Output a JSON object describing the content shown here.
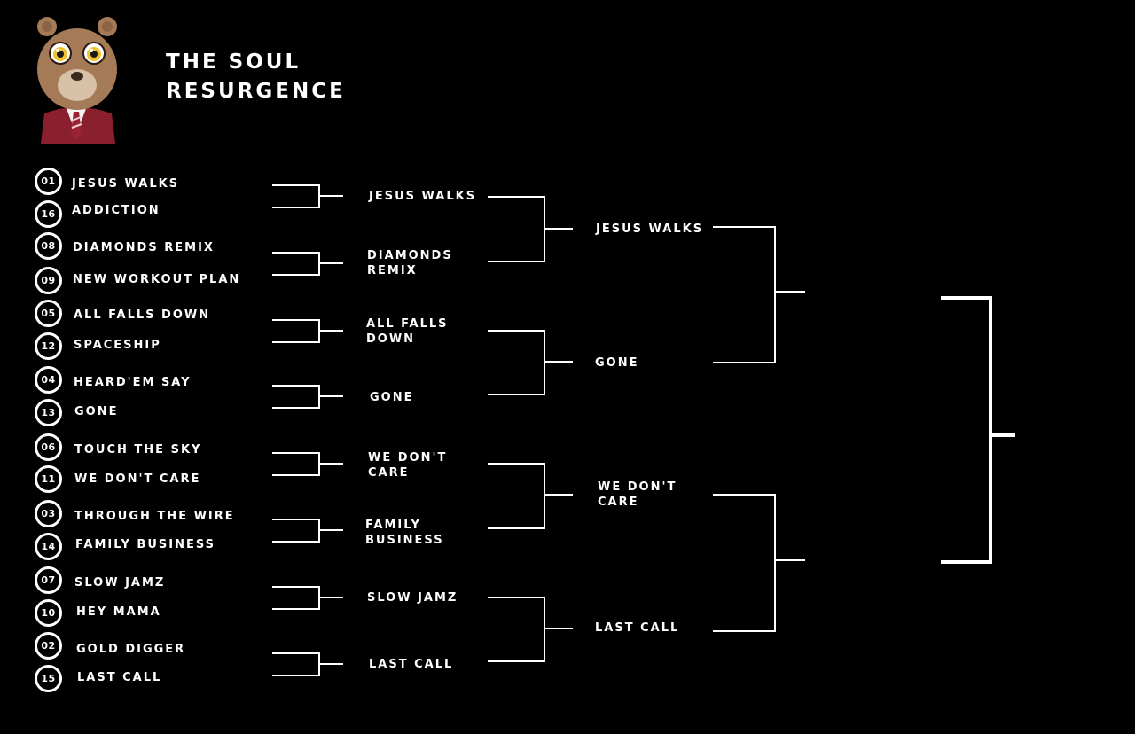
{
  "title": {
    "line1": "THE SOUL",
    "line2": "RESURGENCE"
  },
  "logo": "bear-mascot-icon",
  "round1": [
    {
      "seed": "01",
      "song": "JESUS WALKS"
    },
    {
      "seed": "16",
      "song": "ADDICTION"
    },
    {
      "seed": "08",
      "song": "DIAMONDS REMIX"
    },
    {
      "seed": "09",
      "song": "NEW WORKOUT PLAN"
    },
    {
      "seed": "05",
      "song": "ALL FALLS DOWN"
    },
    {
      "seed": "12",
      "song": "SPACESHIP"
    },
    {
      "seed": "04",
      "song": "HEARD'EM SAY"
    },
    {
      "seed": "13",
      "song": "GONE"
    },
    {
      "seed": "06",
      "song": "TOUCH THE SKY"
    },
    {
      "seed": "11",
      "song": "WE DON'T CARE"
    },
    {
      "seed": "03",
      "song": "THROUGH THE WIRE"
    },
    {
      "seed": "14",
      "song": "FAMILY BUSINESS"
    },
    {
      "seed": "07",
      "song": "SLOW JAMZ"
    },
    {
      "seed": "10",
      "song": "HEY MAMA"
    },
    {
      "seed": "02",
      "song": "GOLD DIGGER"
    },
    {
      "seed": "15",
      "song": "LAST CALL"
    }
  ],
  "round2": [
    "JESUS WALKS",
    "DIAMONDS REMIX",
    "ALL FALLS DOWN",
    "GONE",
    "WE DON'T CARE",
    "FAMILY BUSINESS",
    "SLOW JAMZ",
    "LAST CALL"
  ],
  "round3": [
    "JESUS WALKS",
    "GONE",
    "WE DON'T CARE",
    "LAST CALL"
  ],
  "round4": [
    "",
    ""
  ],
  "final": ""
}
